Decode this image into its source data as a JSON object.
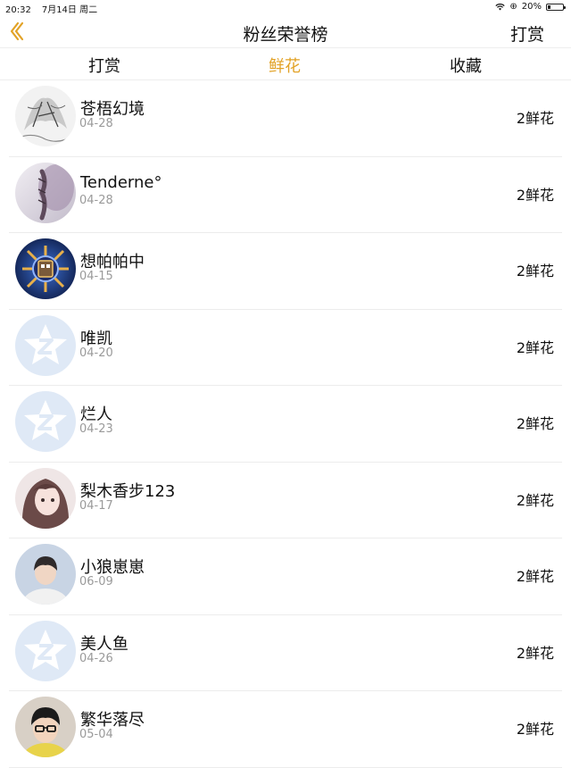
{
  "status": {
    "time": "20:32",
    "date": "7月14日 周二",
    "battery": "20%",
    "battery_level": 0.2
  },
  "nav": {
    "title": "粉丝荣誉榜",
    "action": "打赏"
  },
  "tabs": [
    {
      "label": "打赏",
      "active": false
    },
    {
      "label": "鲜花",
      "active": true
    },
    {
      "label": "收藏",
      "active": false
    }
  ],
  "colors": {
    "accent": "#e2a226",
    "default_avatar_bg": "#dfe9f6"
  },
  "fans": [
    {
      "name": "苍梧幻境",
      "date": "04-28",
      "count": "2鲜花",
      "avatar": "sketch-avatar"
    },
    {
      "name": "Tenderne°",
      "date": "04-28",
      "count": "2鲜花",
      "avatar": "braid-avatar"
    },
    {
      "name": "想帕帕中",
      "date": "04-15",
      "count": "2鲜花",
      "avatar": "badge-avatar"
    },
    {
      "name": "唯凯",
      "date": "04-20",
      "count": "2鲜花",
      "avatar": "default-qq-avatar"
    },
    {
      "name": "烂人",
      "date": "04-23",
      "count": "2鲜花",
      "avatar": "default-qq-avatar"
    },
    {
      "name": "梨木香步123",
      "date": "04-17",
      "count": "2鲜花",
      "avatar": "anime-girl-avatar"
    },
    {
      "name": "小狼崽崽",
      "date": "06-09",
      "count": "2鲜花",
      "avatar": "boy-photo-avatar"
    },
    {
      "name": "美人鱼",
      "date": "04-26",
      "count": "2鲜花",
      "avatar": "default-qq-avatar"
    },
    {
      "name": "繁华落尽",
      "date": "05-04",
      "count": "2鲜花",
      "avatar": "glasses-boy-avatar"
    }
  ]
}
